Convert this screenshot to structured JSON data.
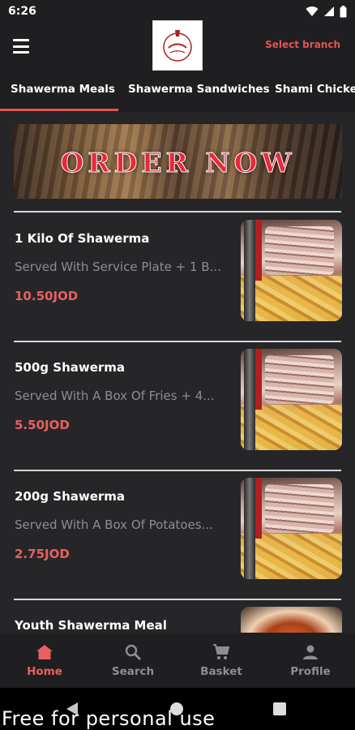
{
  "status_bar": {
    "time": "6:26"
  },
  "app_bar": {
    "select_branch": "Select branch"
  },
  "tabs": [
    {
      "label": "Shawerma Meals",
      "active": true
    },
    {
      "label": "Shawerma Sandwiches",
      "active": false
    },
    {
      "label": "Shami Chicken",
      "active": false
    }
  ],
  "banner": {
    "text": "ORDER NOW"
  },
  "items": [
    {
      "title": "1 Kilo Of Shawerma",
      "description": "Served With Service Plate + 1 B...",
      "price": "10.50JOD"
    },
    {
      "title": "500g Shawerma",
      "description": "Served With A Box Of Fries + 4...",
      "price": "5.50JOD"
    },
    {
      "title": "200g Shawerma",
      "description": "Served With A Box Of Potatoes...",
      "price": "2.75JOD"
    },
    {
      "title": "Youth Shawerma Meal",
      "description": "",
      "price": ""
    }
  ],
  "bottom_nav": [
    {
      "label": "Home",
      "icon": "home-icon",
      "active": true
    },
    {
      "label": "Search",
      "icon": "search-icon",
      "active": false
    },
    {
      "label": "Basket",
      "icon": "cart-icon",
      "active": false
    },
    {
      "label": "Profile",
      "icon": "person-icon",
      "active": false
    }
  ],
  "watermark": "Free for personal use",
  "colors": {
    "accent": "#e86060",
    "background": "#262629",
    "bar": "#1f1f21",
    "muted": "#8d8d92"
  }
}
